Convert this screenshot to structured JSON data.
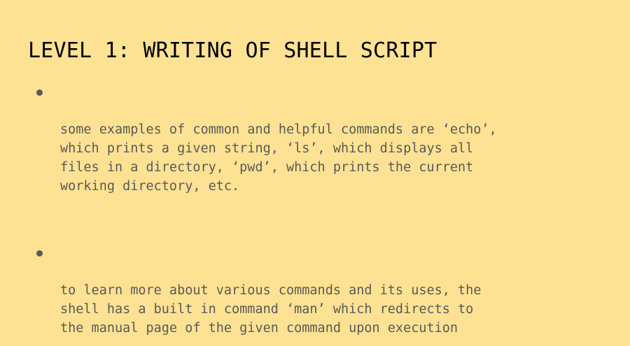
{
  "slide": {
    "title": "LEVEL 1: WRITING OF SHELL SCRIPT",
    "bullets": [
      "some examples of common and helpful commands are ‘echo’,\nwhich prints a given string, ‘ls’, which displays all\nfiles in a directory, ‘pwd’, which prints the current\nworking directory, etc.",
      "to learn more about various commands and its uses, the\nshell has a built in command ‘man’ which redirects to\nthe manual page of the given command upon execution"
    ]
  },
  "colors": {
    "background": "#fde293",
    "title_text": "#000000",
    "body_text": "#595959"
  }
}
